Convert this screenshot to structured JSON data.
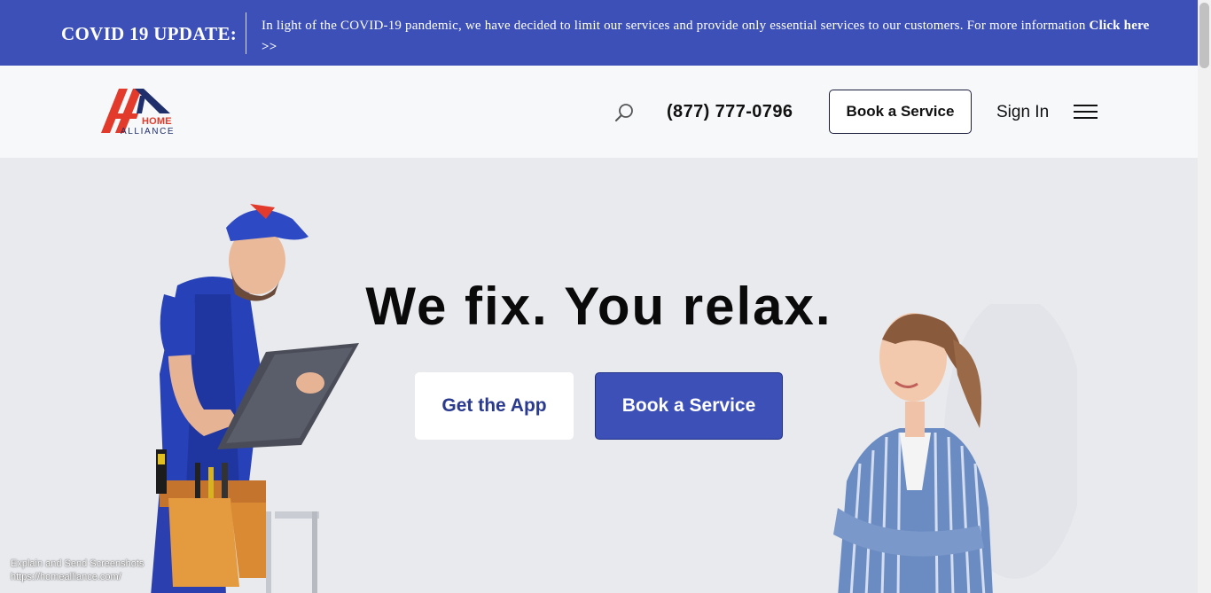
{
  "covid_banner": {
    "title": "COVID 19 UPDATE:",
    "message": "In light of the COVID-19 pandemic, we have decided to limit our services and provide only essential services to our customers. For more information ",
    "link_label": "Click here >>"
  },
  "header": {
    "logo": {
      "word_home": "HOME",
      "word_alliance": "ALLIANCE"
    },
    "search_icon": "search-icon",
    "phone": "(877) 777-0796",
    "book_button": "Book a Service",
    "sign_in": "Sign In",
    "menu_icon": "hamburger-menu-icon"
  },
  "hero": {
    "headline": "We fix. You relax.",
    "get_app_button": "Get the App",
    "book_button": "Book a Service"
  },
  "overlay": {
    "line1": "Explain and Send Screenshots",
    "line2": "https://homealliance.com/"
  },
  "colors": {
    "brand_blue": "#3c50b7",
    "logo_red": "#e33b2b",
    "logo_navy": "#1f2f6b",
    "hero_background": "#e9eaee"
  }
}
